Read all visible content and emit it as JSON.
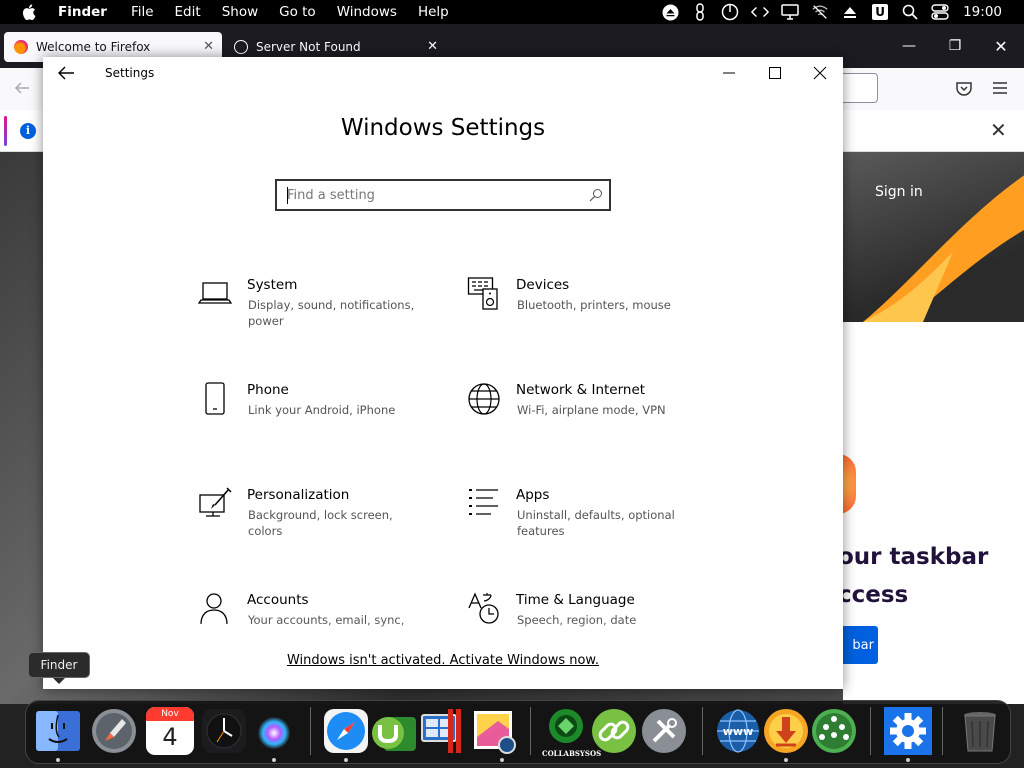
{
  "menubar": {
    "app_name": "Finder",
    "items": [
      "File",
      "Edit",
      "Show",
      "Go to",
      "Windows",
      "Help"
    ],
    "clock": "19:00",
    "badge_letter": "U"
  },
  "firefox": {
    "tab1_title": "Welcome to Firefox",
    "tab2_title": "Server Not Found",
    "sign_in": "Sign in",
    "headline_line1": "our taskbar",
    "headline_line2": "ccess",
    "cta_label": "bar",
    "notice_info_icon": "i"
  },
  "settings": {
    "window_title": "Settings",
    "heading": "Windows Settings",
    "search_placeholder": "Find a setting",
    "tiles": [
      {
        "name": "System",
        "desc": "Display, sound, notifications, power",
        "icon": "laptop-icon"
      },
      {
        "name": "Devices",
        "desc": "Bluetooth, printers, mouse",
        "icon": "devices-icon"
      },
      {
        "name": "Phone",
        "desc": "Link your Android, iPhone",
        "icon": "phone-icon"
      },
      {
        "name": "Network & Internet",
        "desc": "Wi-Fi, airplane mode, VPN",
        "icon": "globe-icon"
      },
      {
        "name": "Personalization",
        "desc": "Background, lock screen, colors",
        "icon": "paintbrush-icon"
      },
      {
        "name": "Apps",
        "desc": "Uninstall, defaults, optional features",
        "icon": "apps-list-icon"
      },
      {
        "name": "Accounts",
        "desc": "Your accounts, email, sync,",
        "icon": "person-icon"
      },
      {
        "name": "Time & Language",
        "desc": "Speech, region, date",
        "icon": "time-language-icon"
      }
    ],
    "activation_text": "Windows isn't activated. Activate Windows now."
  },
  "tooltip": {
    "label": "Finder"
  },
  "dock": {
    "calendar_month": "Nov",
    "calendar_day": "4",
    "collab_label": "COLLABSYSOS",
    "items": [
      "Finder",
      "Launchpad",
      "Calendar",
      "Clock",
      "Siri",
      "Safari",
      "uTorrent",
      "Parallels",
      "Preview",
      "CollabSysOS",
      "Link",
      "System Tools",
      "Web",
      "Downloader",
      "Network",
      "Settings",
      "Trash"
    ]
  },
  "colors": {
    "accent_blue": "#0060df",
    "dock_settings_blue": "#1a73e8",
    "activation_text": "#000000"
  }
}
